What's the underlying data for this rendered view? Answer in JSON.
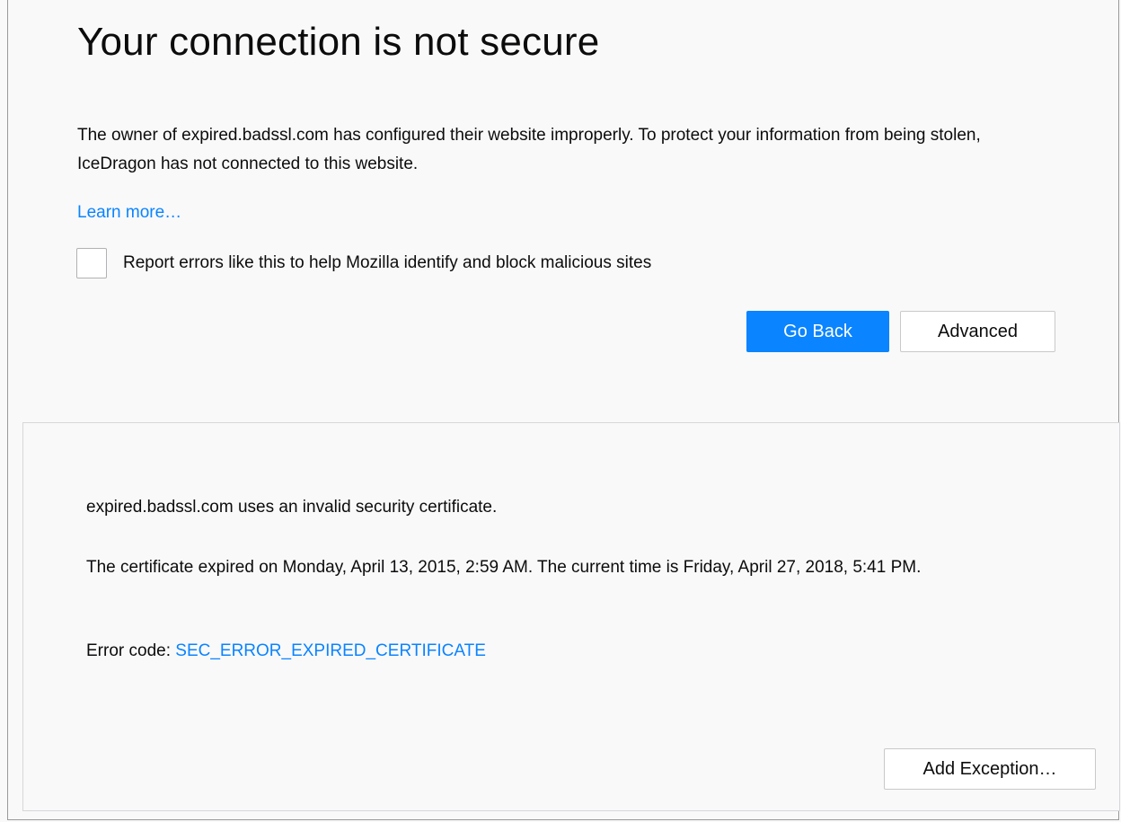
{
  "error_page": {
    "title": "Your connection is not secure",
    "description": "The owner of expired.badssl.com has configured their website improperly. To protect your information from being stolen, IceDragon has not connected to this website.",
    "learn_more_label": "Learn more…",
    "report_checkbox_label": "Report errors like this to help Mozilla identify and block malicious sites",
    "report_checkbox_checked": false,
    "go_back_label": "Go Back",
    "advanced_label": "Advanced"
  },
  "advanced_panel": {
    "invalid_cert_text": "expired.badssl.com uses an invalid security certificate.",
    "expiry_text": "The certificate expired on Monday, April 13, 2015, 2:59 AM. The current time is Friday, April 27, 2018, 5:41 PM.",
    "error_code_prefix": "Error code: ",
    "error_code": "SEC_ERROR_EXPIRED_CERTIFICATE",
    "add_exception_label": "Add Exception…"
  },
  "colors": {
    "accent": "#0a84ff",
    "background": "#f9f9fa",
    "text": "#0c0c0d"
  }
}
